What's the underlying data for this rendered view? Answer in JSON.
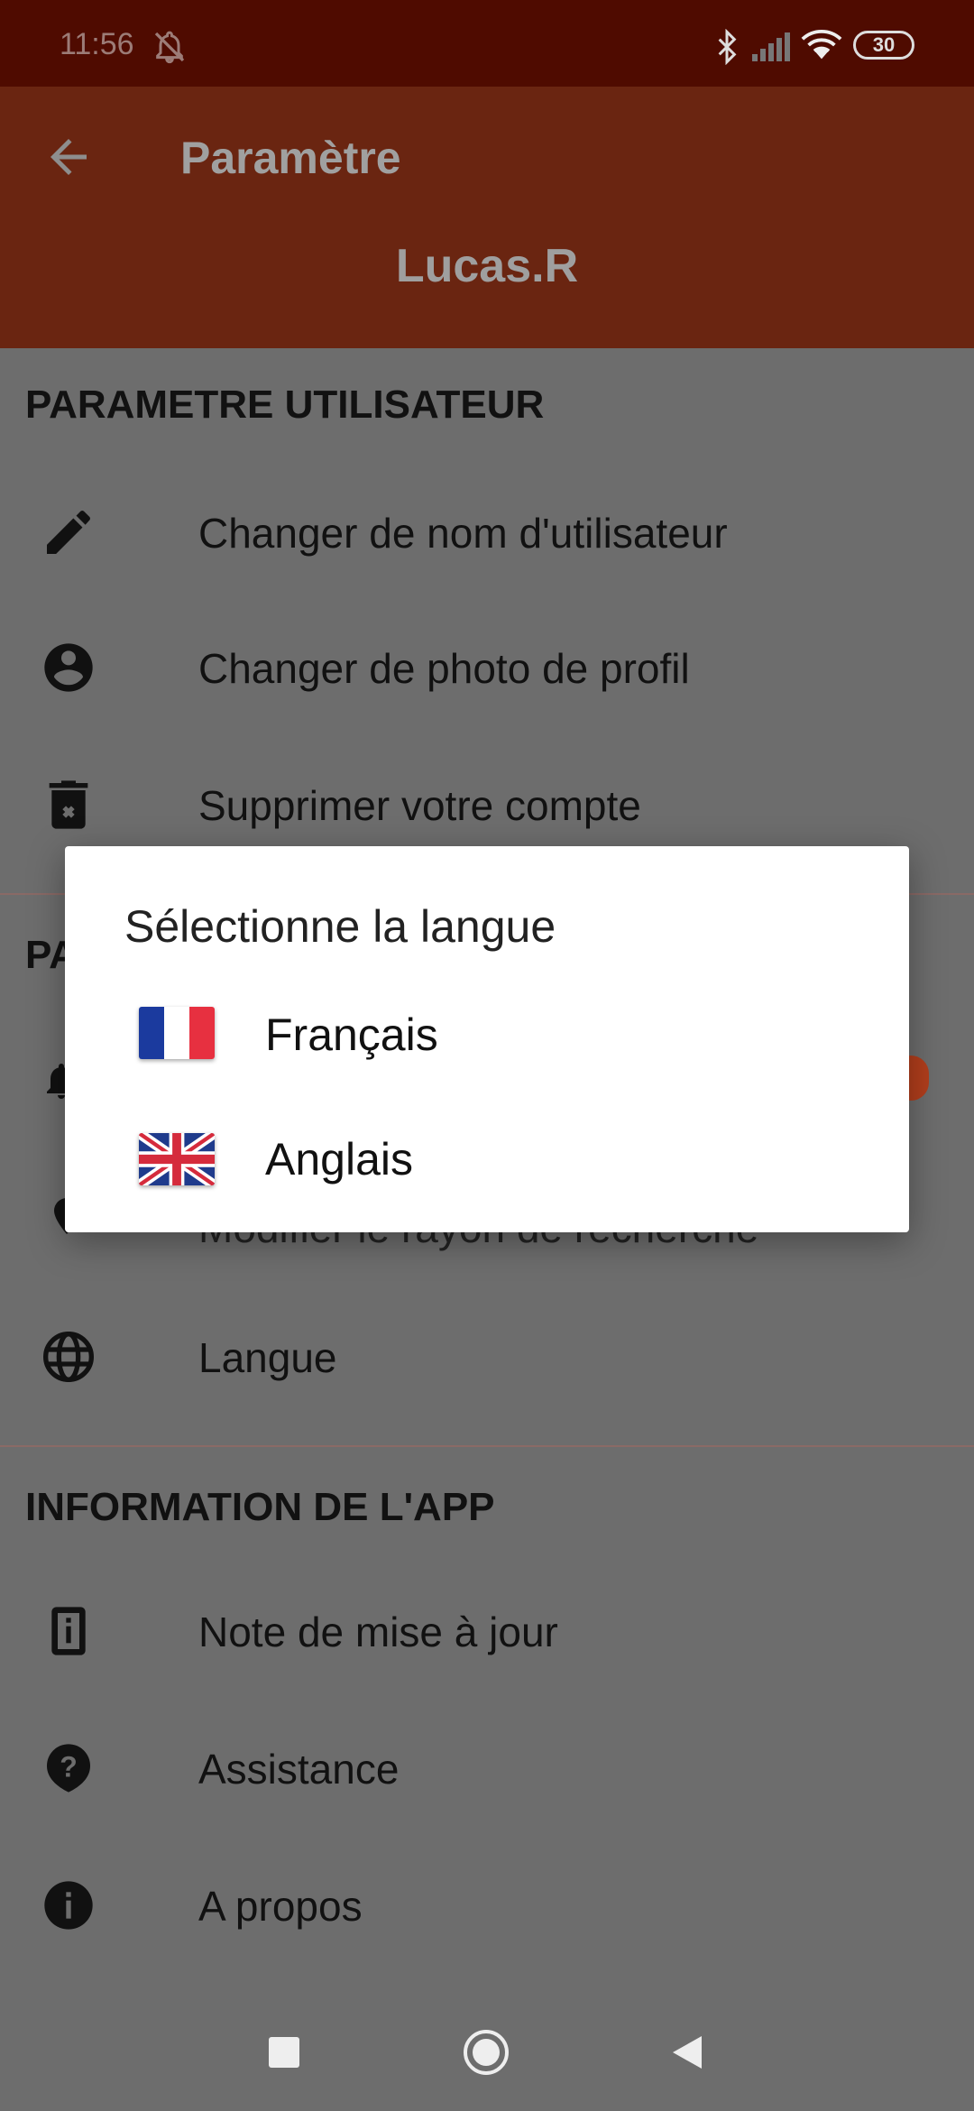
{
  "status_bar": {
    "time": "11:56",
    "battery": "30"
  },
  "app_bar": {
    "title": "Paramètre",
    "username": "Lucas.R"
  },
  "sections": [
    {
      "title": "PARAMETRE UTILISATEUR",
      "items": [
        {
          "label": "Changer de nom d'utilisateur",
          "icon": "pencil-icon"
        },
        {
          "label": "Changer de photo de profil",
          "icon": "account-circle-icon"
        },
        {
          "label": "Supprimer votre compte",
          "icon": "delete-icon"
        }
      ]
    },
    {
      "title_visible": "PA",
      "items": [
        {
          "label_visible": "Modifier le rayon de recherche",
          "icon": "location-icon"
        },
        {
          "label": "Langue",
          "icon": "globe-icon"
        }
      ]
    },
    {
      "title": "INFORMATION DE L'APP",
      "items": [
        {
          "label": "Note de mise à jour",
          "icon": "info-box-icon"
        },
        {
          "label": "Assistance",
          "icon": "help-icon"
        },
        {
          "label": "A propos",
          "icon": "info-icon"
        }
      ]
    }
  ],
  "dialog": {
    "title": "Sélectionne la langue",
    "options": [
      {
        "label": "Français",
        "flag": "france-flag-icon"
      },
      {
        "label": "Anglais",
        "flag": "uk-flag-icon"
      }
    ]
  },
  "colors": {
    "accent": "#c2451c",
    "status_bar": "#4f0b00",
    "app_bar": "#6a2511",
    "scrim": "#6d6d6d"
  }
}
